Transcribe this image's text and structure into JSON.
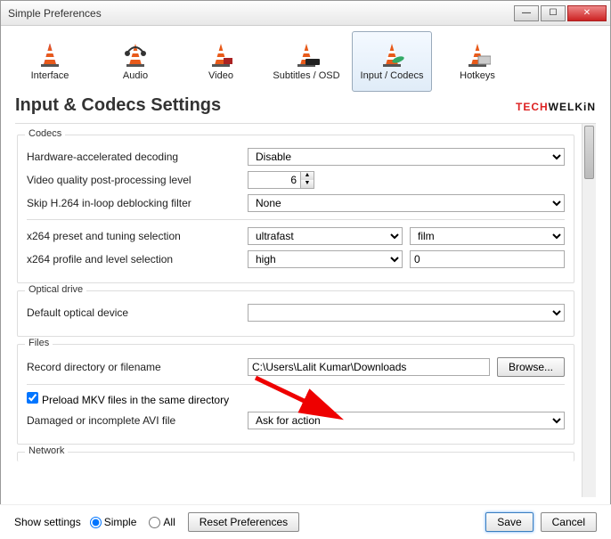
{
  "window": {
    "title": "Simple Preferences"
  },
  "tabs": [
    {
      "label": "Interface"
    },
    {
      "label": "Audio"
    },
    {
      "label": "Video"
    },
    {
      "label": "Subtitles / OSD"
    },
    {
      "label": "Input / Codecs"
    },
    {
      "label": "Hotkeys"
    }
  ],
  "heading": "Input & Codecs Settings",
  "brand": {
    "red": "TECH",
    "black": "WELKiN"
  },
  "sections": {
    "codecs": {
      "legend": "Codecs",
      "hwdecode_label": "Hardware-accelerated decoding",
      "hwdecode_value": "Disable",
      "postproc_label": "Video quality post-processing level",
      "postproc_value": "6",
      "deblock_label": "Skip H.264 in-loop deblocking filter",
      "deblock_value": "None",
      "x264preset_label": "x264 preset and tuning selection",
      "x264preset_value": "ultrafast",
      "x264tune_value": "film",
      "x264profile_label": "x264 profile and level selection",
      "x264profile_value": "high",
      "x264level_value": "0"
    },
    "optical": {
      "legend": "Optical drive",
      "device_label": "Default optical device",
      "device_value": ""
    },
    "files": {
      "legend": "Files",
      "recdir_label": "Record directory or filename",
      "recdir_value": "C:\\Users\\Lalit Kumar\\Downloads",
      "browse_label": "Browse...",
      "preload_label": "Preload MKV files in the same directory",
      "damaged_label": "Damaged or incomplete AVI file",
      "damaged_value": "Ask for action"
    },
    "network": {
      "legend": "Network"
    }
  },
  "footer": {
    "showsettings_label": "Show settings",
    "simple_label": "Simple",
    "all_label": "All",
    "reset_label": "Reset Preferences",
    "save_label": "Save",
    "cancel_label": "Cancel"
  }
}
